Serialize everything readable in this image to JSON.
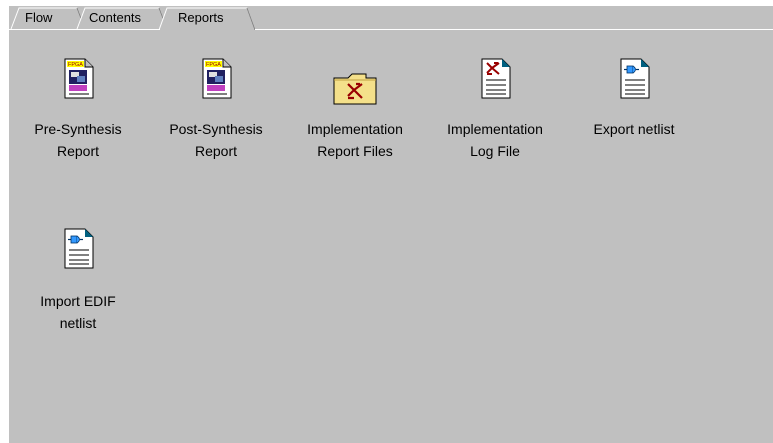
{
  "tabs": [
    {
      "label": "Flow",
      "active": false
    },
    {
      "label": "Contents",
      "active": false
    },
    {
      "label": "Reports",
      "active": true
    }
  ],
  "items": [
    {
      "line1": "Pre-Synthesis",
      "line2": "Report",
      "icon": "fpga-report-icon"
    },
    {
      "line1": "Post-Synthesis",
      "line2": "Report",
      "icon": "fpga-report-icon"
    },
    {
      "line1": "Implementation",
      "line2": "Report Files",
      "icon": "xilinx-folder-icon"
    },
    {
      "line1": "Implementation",
      "line2": "Log File",
      "icon": "xilinx-document-icon"
    },
    {
      "line1": "Export netlist",
      "line2": "",
      "icon": "netlist-document-icon"
    },
    {
      "line1": "Import EDIF",
      "line2": "netlist",
      "icon": "netlist-document-icon"
    }
  ],
  "fpga_badge_text": "FPGA",
  "colors": {
    "panel_background": "#c0c0c0",
    "folder_yellow": "#f4e08a",
    "xilinx_red": "#990000",
    "plug_blue": "#3399ff"
  }
}
